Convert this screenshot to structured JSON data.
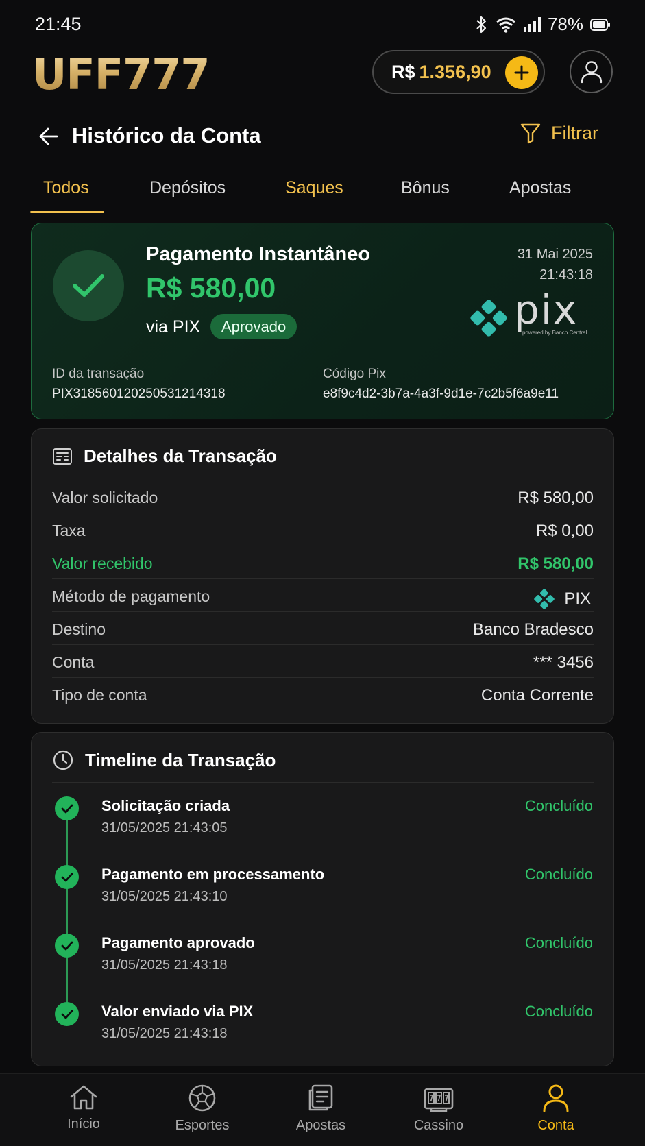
{
  "status_bar": {
    "time": "21:45",
    "battery": "78%"
  },
  "brand": {
    "logo_text": "UFF777",
    "gold": "#f2c14e",
    "green": "#31c56b"
  },
  "balance": {
    "currency": "R$",
    "amount": "1.356,90"
  },
  "header": {
    "title": "Histórico da Conta",
    "filter_label": "Filtrar"
  },
  "tabs": [
    {
      "label": "Todos",
      "active": true
    },
    {
      "label": "Depósitos"
    },
    {
      "label": "Saques"
    },
    {
      "label": "Bônus"
    },
    {
      "label": "Apostas"
    }
  ],
  "summary": {
    "title": "Pagamento Instantâneo",
    "amount": "R$ 580,00",
    "via": "via PIX",
    "badge": "Aprovado",
    "date": "31 Mai 2025",
    "time": "21:43:18",
    "pix_wordmark": "pix",
    "pix_tagline": "powered by Banco Central",
    "id_label": "ID da transação",
    "id_value": "PIX318560120250531214318",
    "code_label": "Código Pix",
    "code_value": "e8f9c4d2-3b7a-4a3f-9d1e-7c2b5f6a9e11"
  },
  "details": {
    "title": "Detalhes da Transação",
    "rows": [
      {
        "label": "Valor solicitado",
        "value": "R$ 580,00"
      },
      {
        "label": "Taxa",
        "value": "R$ 0,00"
      },
      {
        "label": "Valor recebido",
        "value": "R$ 580,00"
      },
      {
        "label": "Método de pagamento",
        "value": "PIX"
      },
      {
        "label": "Destino",
        "value": "Banco Bradesco"
      },
      {
        "label": "Conta",
        "value": "*** 3456"
      },
      {
        "label": "Tipo de conta",
        "value": "Conta Corrente"
      }
    ]
  },
  "timeline": {
    "title": "Timeline da Transação",
    "steps": [
      {
        "title": "Solicitação criada",
        "time": "31/05/2025 21:43:05",
        "status": "Concluído"
      },
      {
        "title": "Pagamento em processamento",
        "time": "31/05/2025 21:43:10",
        "status": "Concluído"
      },
      {
        "title": "Pagamento aprovado",
        "time": "31/05/2025 21:43:18",
        "status": "Concluído"
      },
      {
        "title": "Valor enviado via PIX",
        "time": "31/05/2025 21:43:18",
        "status": "Concluído"
      }
    ]
  },
  "bottom_nav": [
    {
      "label": "Início",
      "icon": "home-icon"
    },
    {
      "label": "Esportes",
      "icon": "soccer-ball-icon"
    },
    {
      "label": "Apostas",
      "icon": "bet-slip-icon"
    },
    {
      "label": "Cassino",
      "icon": "slot-machine-icon"
    },
    {
      "label": "Conta",
      "icon": "user-icon",
      "active": true
    }
  ]
}
